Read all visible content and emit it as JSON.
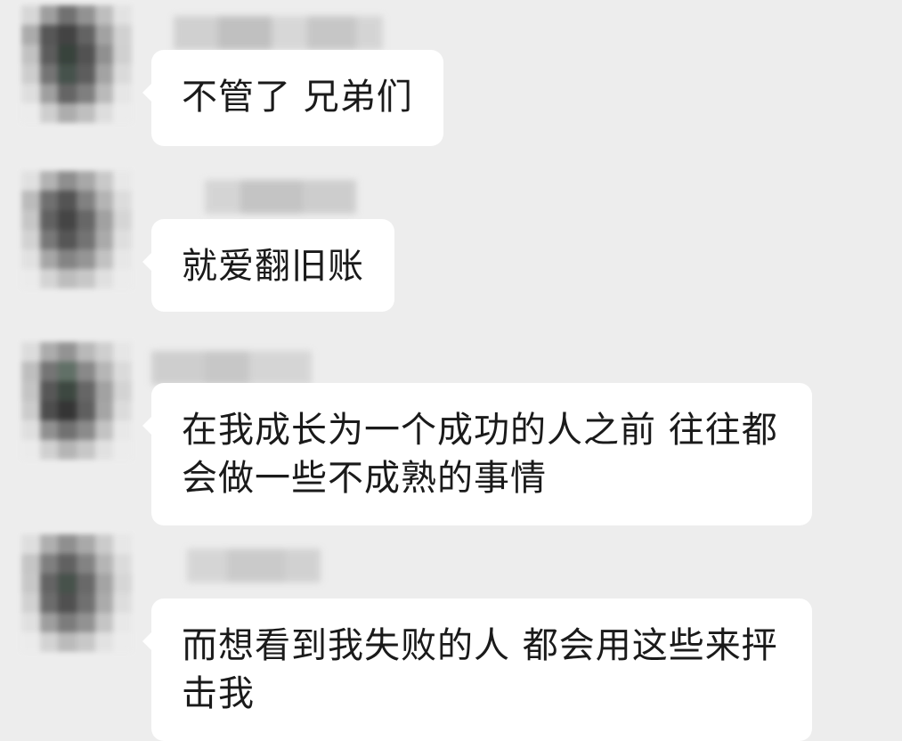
{
  "messages": [
    {
      "text": "不管了 兄弟们"
    },
    {
      "text": "就爱翻旧账"
    },
    {
      "text": "在我成长为一个成功的人之前 往往都会做一些不成熟的事情"
    },
    {
      "text": "而想看到我失败的人 都会用这些来抨击我"
    }
  ],
  "colors": {
    "background": "#ededed",
    "bubble": "#ffffff",
    "text": "#1a1a1a"
  }
}
